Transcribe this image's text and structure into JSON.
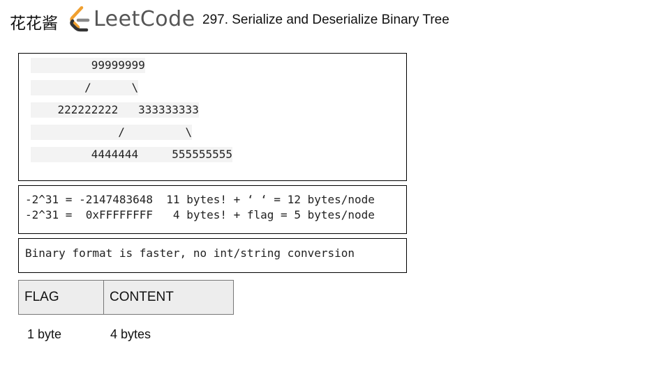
{
  "header": {
    "brand_cn": "花花酱",
    "brand_en": "LeetCode",
    "logo_icon": "leetcode-logo-icon",
    "title": "297. Serialize and Deserialize Binary Tree"
  },
  "tree_example": {
    "lines": [
      "         99999999",
      "        /      \\",
      "    222222222   333333333",
      "             /         \\",
      "         4444444     555555555"
    ]
  },
  "byte_sizes": {
    "lines": [
      "-2^31 = -2147483648  11 bytes! + ‘ ‘ = 12 bytes/node",
      "-2^31 =  0xFFFFFFFF   4 bytes! + flag = 5 bytes/node"
    ]
  },
  "note": "Binary format is faster, no int/string conversion",
  "node_format": {
    "cells": [
      "FLAG",
      "CONTENT"
    ],
    "sizes": [
      "1 byte",
      "4 bytes"
    ]
  },
  "colors": {
    "logo_orange": "#f0a030",
    "logo_gray": "#555555",
    "cell_fill": "#ededed",
    "code_highlight": "#f3f3f3"
  }
}
